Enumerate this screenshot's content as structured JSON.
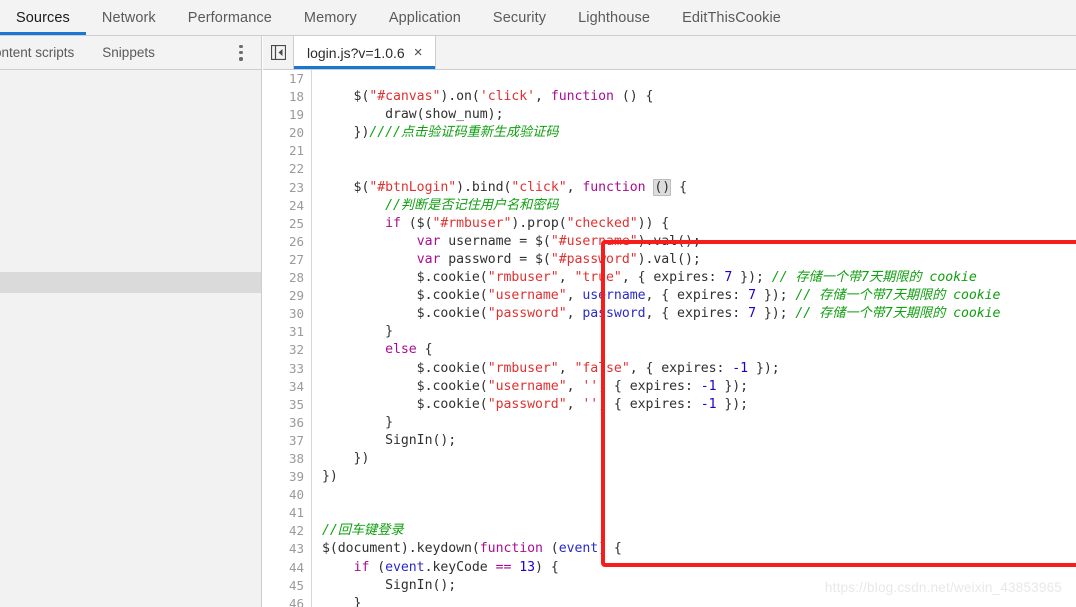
{
  "devtools": {
    "panel_tabs": [
      {
        "label": "Sources",
        "active": true
      },
      {
        "label": "Network",
        "active": false
      },
      {
        "label": "Performance",
        "active": false
      },
      {
        "label": "Memory",
        "active": false
      },
      {
        "label": "Application",
        "active": false
      },
      {
        "label": "Security",
        "active": false
      },
      {
        "label": "Lighthouse",
        "active": false
      },
      {
        "label": "EditThisCookie",
        "active": false
      }
    ],
    "accent_color": "#1976d2",
    "panel_bg": "#f3f3f3",
    "border_color": "#cdcdcd"
  },
  "navigator": {
    "subtabs": [
      {
        "label": "ontent scripts",
        "clipped": true
      },
      {
        "label": "Snippets",
        "clipped": false
      }
    ],
    "more_options_label": "More options",
    "selected_band_color": "#dadada"
  },
  "editor": {
    "sidebar_toggle_label": "Show navigator",
    "file_tab": {
      "label": "login.js?v=1.0.6",
      "close_label": "×"
    },
    "first_line_number": 17,
    "lines": [
      {
        "n": 17,
        "tokens": []
      },
      {
        "n": 18,
        "tokens": [
          {
            "t": "plain",
            "s": "    $("
          },
          {
            "t": "str",
            "s": "\"#canvas\""
          },
          {
            "t": "plain",
            "s": ").on("
          },
          {
            "t": "str",
            "s": "'click'"
          },
          {
            "t": "plain",
            "s": ", "
          },
          {
            "t": "kw",
            "s": "function"
          },
          {
            "t": "plain",
            "s": " () {"
          }
        ]
      },
      {
        "n": 19,
        "tokens": [
          {
            "t": "plain",
            "s": "        draw(show_num);"
          }
        ]
      },
      {
        "n": 20,
        "tokens": [
          {
            "t": "plain",
            "s": "    })"
          },
          {
            "t": "com",
            "s": "////点击验证码重新生成验证码"
          }
        ]
      },
      {
        "n": 21,
        "tokens": []
      },
      {
        "n": 22,
        "tokens": []
      },
      {
        "n": 23,
        "tokens": [
          {
            "t": "plain",
            "s": "    $("
          },
          {
            "t": "str",
            "s": "\"#btnLogin\""
          },
          {
            "t": "plain",
            "s": ").bind("
          },
          {
            "t": "str",
            "s": "\"click\""
          },
          {
            "t": "plain",
            "s": ", "
          },
          {
            "t": "kw",
            "s": "function"
          },
          {
            "t": "plain",
            "s": " "
          },
          {
            "t": "bracket",
            "s": "()"
          },
          {
            "t": "plain",
            "s": " {"
          }
        ]
      },
      {
        "n": 24,
        "tokens": [
          {
            "t": "plain",
            "s": "        "
          },
          {
            "t": "com",
            "s": "//判断是否记住用户名和密码"
          }
        ]
      },
      {
        "n": 25,
        "tokens": [
          {
            "t": "plain",
            "s": "        "
          },
          {
            "t": "kw",
            "s": "if"
          },
          {
            "t": "plain",
            "s": " ($("
          },
          {
            "t": "str",
            "s": "\"#rmbuser\""
          },
          {
            "t": "plain",
            "s": ").prop("
          },
          {
            "t": "str",
            "s": "\"checked\""
          },
          {
            "t": "plain",
            "s": ")) {"
          }
        ]
      },
      {
        "n": 26,
        "tokens": [
          {
            "t": "plain",
            "s": "            "
          },
          {
            "t": "kw",
            "s": "var"
          },
          {
            "t": "plain",
            "s": " username = $("
          },
          {
            "t": "str",
            "s": "\"#username\""
          },
          {
            "t": "plain",
            "s": ").val();"
          }
        ]
      },
      {
        "n": 27,
        "tokens": [
          {
            "t": "plain",
            "s": "            "
          },
          {
            "t": "kw",
            "s": "var"
          },
          {
            "t": "plain",
            "s": " password = $("
          },
          {
            "t": "str",
            "s": "\"#password\""
          },
          {
            "t": "plain",
            "s": ").val();"
          }
        ]
      },
      {
        "n": 28,
        "tokens": [
          {
            "t": "plain",
            "s": "            $.cookie("
          },
          {
            "t": "str",
            "s": "\"rmbuser\""
          },
          {
            "t": "plain",
            "s": ", "
          },
          {
            "t": "str",
            "s": "\"true\""
          },
          {
            "t": "plain",
            "s": ", { expires: "
          },
          {
            "t": "num",
            "s": "7"
          },
          {
            "t": "plain",
            "s": " }); "
          },
          {
            "t": "com",
            "s": "// 存储一个带7天期限的 cookie"
          }
        ]
      },
      {
        "n": 29,
        "tokens": [
          {
            "t": "plain",
            "s": "            $.cookie("
          },
          {
            "t": "str",
            "s": "\"username\""
          },
          {
            "t": "plain",
            "s": ", "
          },
          {
            "t": "var",
            "s": "username"
          },
          {
            "t": "plain",
            "s": ", { expires: "
          },
          {
            "t": "num",
            "s": "7"
          },
          {
            "t": "plain",
            "s": " }); "
          },
          {
            "t": "com",
            "s": "// 存储一个带7天期限的 cookie"
          }
        ]
      },
      {
        "n": 30,
        "tokens": [
          {
            "t": "plain",
            "s": "            $.cookie("
          },
          {
            "t": "str",
            "s": "\"password\""
          },
          {
            "t": "plain",
            "s": ", "
          },
          {
            "t": "var",
            "s": "password"
          },
          {
            "t": "plain",
            "s": ", { expires: "
          },
          {
            "t": "num",
            "s": "7"
          },
          {
            "t": "plain",
            "s": " }); "
          },
          {
            "t": "com",
            "s": "// 存储一个带7天期限的 cookie"
          }
        ]
      },
      {
        "n": 31,
        "tokens": [
          {
            "t": "plain",
            "s": "        }"
          }
        ]
      },
      {
        "n": 32,
        "tokens": [
          {
            "t": "plain",
            "s": "        "
          },
          {
            "t": "kw",
            "s": "else"
          },
          {
            "t": "plain",
            "s": " {"
          }
        ]
      },
      {
        "n": 33,
        "tokens": [
          {
            "t": "plain",
            "s": "            $.cookie("
          },
          {
            "t": "str",
            "s": "\"rmbuser\""
          },
          {
            "t": "plain",
            "s": ", "
          },
          {
            "t": "str",
            "s": "\"false\""
          },
          {
            "t": "plain",
            "s": ", { expires: "
          },
          {
            "t": "num",
            "s": "-1"
          },
          {
            "t": "plain",
            "s": " });"
          }
        ]
      },
      {
        "n": 34,
        "tokens": [
          {
            "t": "plain",
            "s": "            $.cookie("
          },
          {
            "t": "str",
            "s": "\"username\""
          },
          {
            "t": "plain",
            "s": ", "
          },
          {
            "t": "str",
            "s": "''"
          },
          {
            "t": "plain",
            "s": ", { expires: "
          },
          {
            "t": "num",
            "s": "-1"
          },
          {
            "t": "plain",
            "s": " });"
          }
        ]
      },
      {
        "n": 35,
        "tokens": [
          {
            "t": "plain",
            "s": "            $.cookie("
          },
          {
            "t": "str",
            "s": "\"password\""
          },
          {
            "t": "plain",
            "s": ", "
          },
          {
            "t": "str",
            "s": "''"
          },
          {
            "t": "plain",
            "s": ", { expires: "
          },
          {
            "t": "num",
            "s": "-1"
          },
          {
            "t": "plain",
            "s": " });"
          }
        ]
      },
      {
        "n": 36,
        "tokens": [
          {
            "t": "plain",
            "s": "        }"
          }
        ]
      },
      {
        "n": 37,
        "tokens": [
          {
            "t": "plain",
            "s": "        SignIn();"
          }
        ]
      },
      {
        "n": 38,
        "tokens": [
          {
            "t": "plain",
            "s": "    })"
          }
        ]
      },
      {
        "n": 39,
        "tokens": [
          {
            "t": "plain",
            "s": "})"
          }
        ]
      },
      {
        "n": 40,
        "tokens": []
      },
      {
        "n": 41,
        "tokens": []
      },
      {
        "n": 42,
        "tokens": [
          {
            "t": "com",
            "s": "//回车键登录"
          }
        ]
      },
      {
        "n": 43,
        "tokens": [
          {
            "t": "plain",
            "s": "$(document).keydown("
          },
          {
            "t": "kw",
            "s": "function"
          },
          {
            "t": "plain",
            "s": " ("
          },
          {
            "t": "var",
            "s": "event"
          },
          {
            "t": "plain",
            "s": ") {"
          }
        ]
      },
      {
        "n": 44,
        "tokens": [
          {
            "t": "plain",
            "s": "    "
          },
          {
            "t": "kw",
            "s": "if"
          },
          {
            "t": "plain",
            "s": " ("
          },
          {
            "t": "var",
            "s": "event"
          },
          {
            "t": "plain",
            "s": ".keyCode "
          },
          {
            "t": "kw",
            "s": "=="
          },
          {
            "t": "plain",
            "s": " "
          },
          {
            "t": "num",
            "s": "13"
          },
          {
            "t": "plain",
            "s": ") {"
          }
        ]
      },
      {
        "n": 45,
        "tokens": [
          {
            "t": "plain",
            "s": "        SignIn();"
          }
        ]
      },
      {
        "n": 46,
        "tokens": [
          {
            "t": "plain",
            "s": "    }"
          }
        ]
      }
    ]
  },
  "annotation": {
    "highlight_color": "#f81d1d",
    "covers_lines": "23-39"
  },
  "watermark": {
    "text": "https://blog.csdn.net/weixin_43853965"
  }
}
